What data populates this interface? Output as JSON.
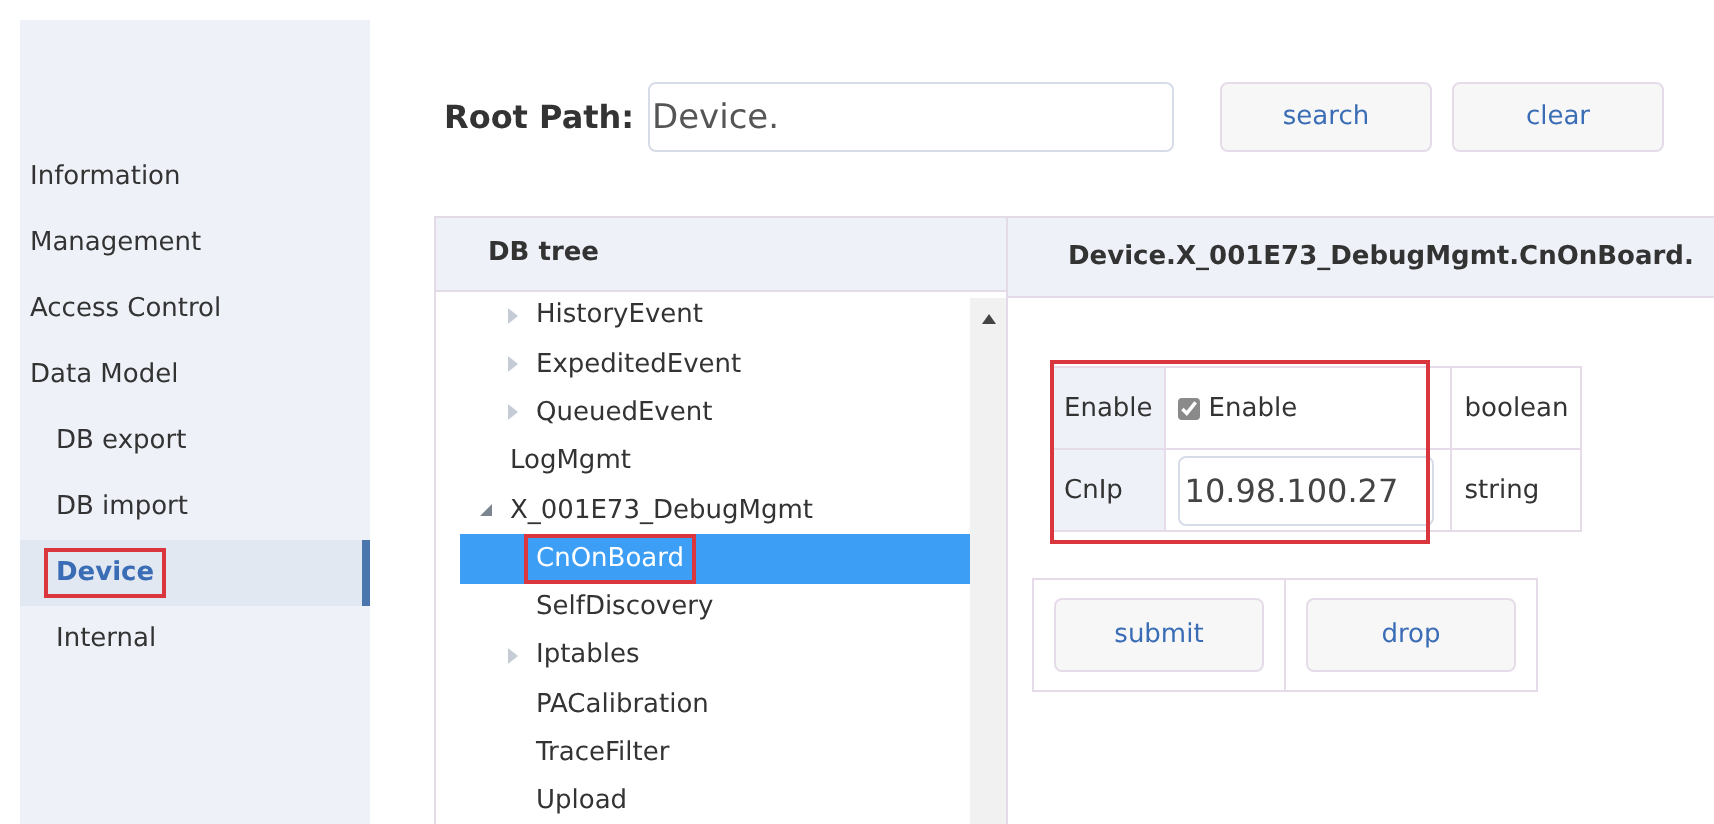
{
  "sidebar": {
    "items": [
      {
        "label": "Information",
        "selected": false
      },
      {
        "label": "Management",
        "selected": false
      },
      {
        "label": "Access Control",
        "selected": false
      },
      {
        "label": "Data Model",
        "selected": false,
        "children": [
          {
            "label": "DB export",
            "selected": false
          },
          {
            "label": "DB import",
            "selected": false
          },
          {
            "label": "Device",
            "selected": true,
            "highlighted": true
          },
          {
            "label": "Internal",
            "selected": false
          }
        ]
      }
    ]
  },
  "search": {
    "label": "Root Path:",
    "value": "Device.",
    "buttons": [
      "search",
      "clear"
    ]
  },
  "tree": {
    "title": "DB tree",
    "items": [
      {
        "children": [
          {
            "label": "HistoryEvent",
            "selected": false,
            "expanded": false
          },
          {
            "label": "ExpeditedEvent",
            "selected": false,
            "expanded": false
          },
          {
            "label": "QueuedEvent",
            "selected": false,
            "expanded": false
          }
        ]
      },
      {
        "label": "LogMgmt",
        "selected": false
      },
      {
        "label": "X_001E73_DebugMgmt",
        "selected": false,
        "expanded": true,
        "children": [
          {
            "label": "CnOnBoard",
            "selected": true,
            "highlighted": true
          },
          {
            "label": "SelfDiscovery",
            "selected": false
          },
          {
            "label": "Iptables",
            "selected": false,
            "expanded": false
          },
          {
            "label": "PACalibration",
            "selected": false
          },
          {
            "label": "TraceFilter",
            "selected": false
          },
          {
            "label": "Upload",
            "selected": false
          }
        ]
      }
    ]
  },
  "detail": {
    "title": "Device.X_001E73_DebugMgmt.CnOnBoard.",
    "highlighted": true,
    "params": [
      {
        "name": "Enable",
        "kind": "checkbox",
        "label": "Enable",
        "checked": true,
        "type": "boolean"
      },
      {
        "name": "CnIp",
        "kind": "text",
        "value": "10.98.100.27",
        "type": "string"
      }
    ],
    "buttons": [
      "submit",
      "drop"
    ]
  }
}
